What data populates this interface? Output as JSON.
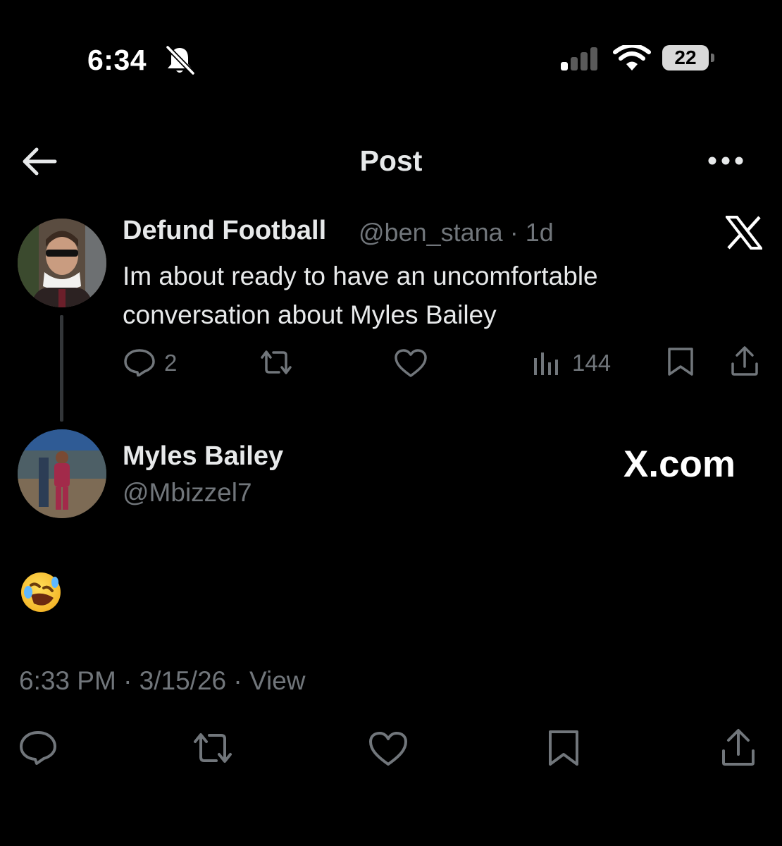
{
  "status_bar": {
    "time": "6:34",
    "battery": "22",
    "icons": [
      "bell-slash-icon",
      "cellular-signal-icon",
      "wifi-icon",
      "battery-icon"
    ]
  },
  "nav": {
    "title": "Post",
    "icons": [
      "back-arrow-icon",
      "more-icon"
    ]
  },
  "quoted_post": {
    "display_name": "Defund Football",
    "handle_time": "@ben_stana · 1d",
    "text": "Im about ready to have an uncomfortable conversation about Myles Bailey",
    "replies": "2",
    "views": "144"
  },
  "reply_post": {
    "display_name": "Myles Bailey",
    "handle": "@Mbizzel7",
    "watermark": "X.com",
    "body_emoji": "🤣",
    "meta": "6:33 PM · 3/15/26 · View"
  },
  "colors": {
    "background": "#000000",
    "primary_text": "#e7e9ea",
    "secondary_text": "#71767b",
    "thread_line": "#333639"
  }
}
